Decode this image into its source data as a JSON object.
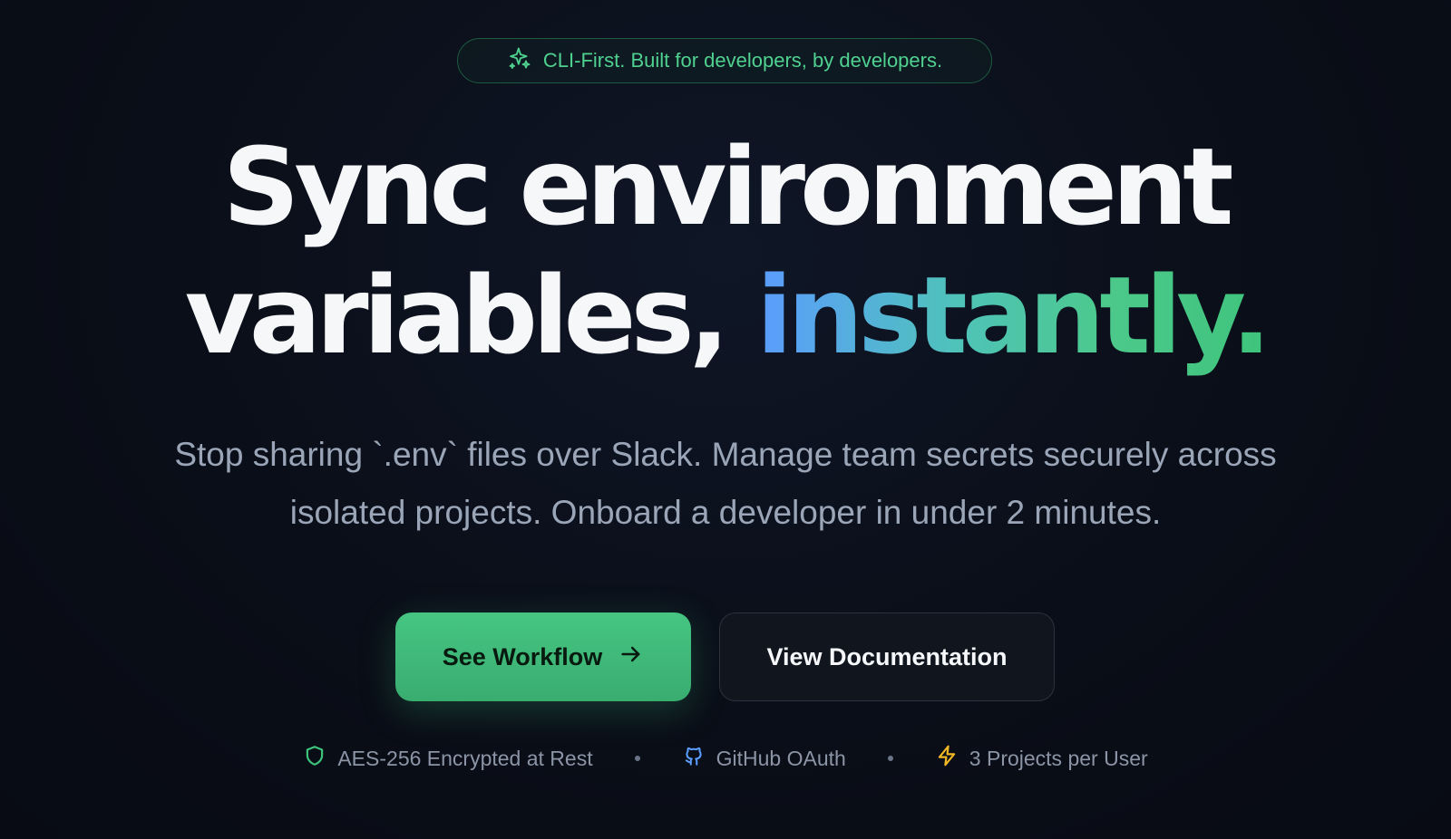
{
  "badge": {
    "icon": "sparkles-icon",
    "text": "CLI-First. Built for developers, by developers.",
    "color": "#4fd190"
  },
  "headline": {
    "line1": "Sync environment",
    "line2_plain": "variables,",
    "line2_highlight": "instantly."
  },
  "subtitle": {
    "line1": "Stop sharing `.env` files over Slack. Manage team secrets securely across",
    "line2": "isolated projects. Onboard a developer in under 2 minutes."
  },
  "buttons": {
    "primary": {
      "label": "See Workflow",
      "icon": "arrow-right-icon",
      "color": "#46c582"
    },
    "secondary": {
      "label": "View Documentation"
    }
  },
  "features": [
    {
      "icon": "shield-icon",
      "label": "AES-256 Encrypted at Rest",
      "color": "#3ec47c"
    },
    {
      "icon": "github-icon",
      "label": "GitHub OAuth",
      "color": "#5b9cff"
    },
    {
      "icon": "lightning-icon",
      "label": "3 Projects per User",
      "color": "#f2b824"
    }
  ]
}
